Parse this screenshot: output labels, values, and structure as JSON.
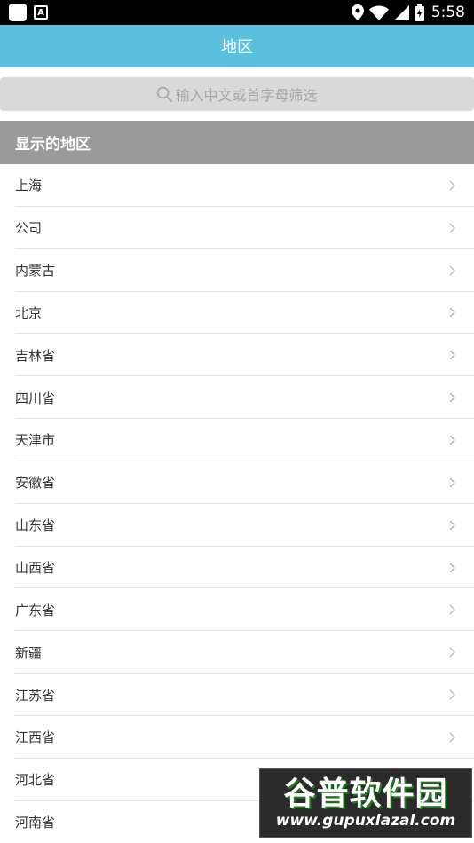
{
  "status_bar": {
    "time": "5:58",
    "icons": [
      "app-icon",
      "a-notification-icon",
      "location-icon",
      "wifi-icon",
      "signal-icon",
      "battery-icon"
    ]
  },
  "app_bar": {
    "title": "地区",
    "color": "#5bc0de"
  },
  "search": {
    "placeholder": "输入中文或首字母筛选"
  },
  "section": {
    "title": "显示的地区"
  },
  "regions": [
    "上海",
    "公司",
    "内蒙古",
    "北京",
    "吉林省",
    "四川省",
    "天津市",
    "安徽省",
    "山东省",
    "山西省",
    "广东省",
    "新疆",
    "江苏省",
    "江西省",
    "河北省",
    "河南省"
  ],
  "watermark": {
    "title": "谷普软件园",
    "url": "www.gupuxlazal.com"
  }
}
